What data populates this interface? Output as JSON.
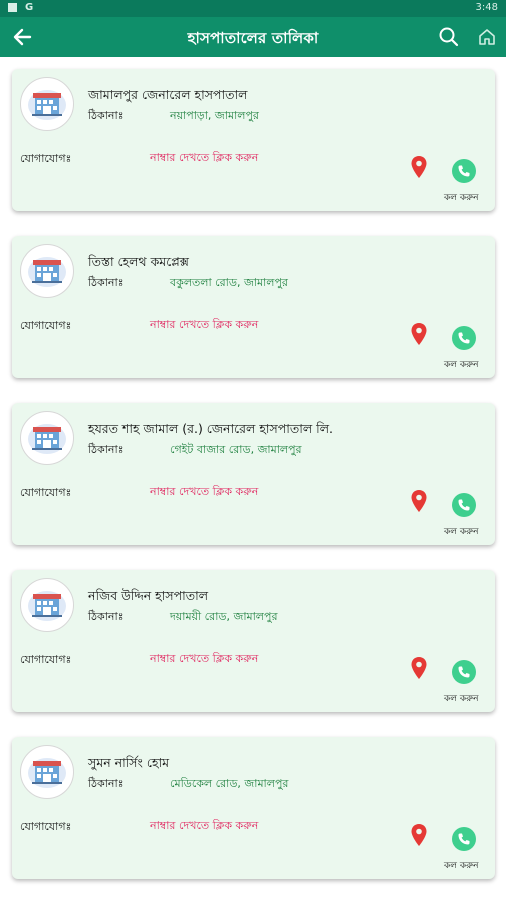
{
  "status_bar": {
    "time": "3:48",
    "g_label": "G"
  },
  "header": {
    "title": "হাসপাতালের তালিকা"
  },
  "labels": {
    "address": "ঠিকানাঃ",
    "contact": "যোগাযোগঃ",
    "contact_value": "নাম্বার দেখতে ক্লিক করুন",
    "call": "কল করুন"
  },
  "colors": {
    "appbar": "#0f8f6a",
    "card_bg": "#ebf8ee",
    "address_text": "#1b7e3c",
    "contact_text": "#e0245e",
    "call_button": "#3ecf8e",
    "pin": "#e53935"
  },
  "hospitals": [
    {
      "name": "জামালপুর জেনারেল হাসপাতাল",
      "address": "নয়াপাড়া, জামালপুর"
    },
    {
      "name": "তিস্তা হেলথ কমপ্লেক্স",
      "address": "বকুলতলা রোড, জামালপুর"
    },
    {
      "name": "হযরত শাহ জামাল (র.) জেনারেল হাসপাতাল লি.",
      "address": "গেইট বাজার রোড, জামালপুর"
    },
    {
      "name": "নজিব উদ্দিন হাসপাতাল",
      "address": "দয়াময়ী রোড, জামালপুর"
    },
    {
      "name": "সুমন নার্সিং হোম",
      "address": "মেডিকেল রোড, জামালপুর"
    }
  ]
}
